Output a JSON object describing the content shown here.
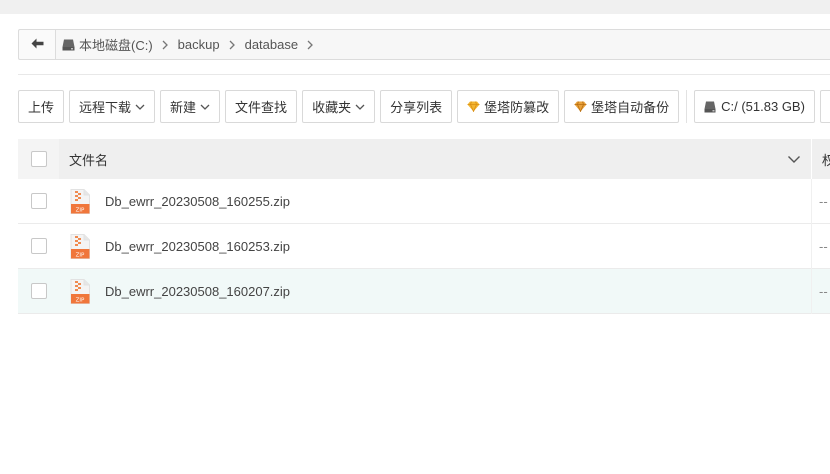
{
  "address_bar": {
    "crumbs": [
      "本地磁盘(C:)",
      "backup",
      "database"
    ]
  },
  "toolbar": {
    "upload": "上传",
    "remote_download": "远程下载",
    "new": "新建",
    "file_search": "文件查找",
    "favorites": "收藏夹",
    "share_list": "分享列表",
    "tamper_proof": "堡塔防篡改",
    "auto_backup": "堡塔自动备份",
    "disk_c": "C:/ (51.83 GB)"
  },
  "table": {
    "header_name": "文件名",
    "header_next": "权",
    "rows": [
      {
        "name": "Db_ewrr_20230508_160255.zip",
        "trailing": "--"
      },
      {
        "name": "Db_ewrr_20230508_160253.zip",
        "trailing": "--"
      },
      {
        "name": "Db_ewrr_20230508_160207.zip",
        "trailing": "--"
      }
    ]
  },
  "colors": {
    "accent_gold": "#e8a92a",
    "zip_orange": "#f0763b",
    "selected_row": "#f1f9f8"
  }
}
